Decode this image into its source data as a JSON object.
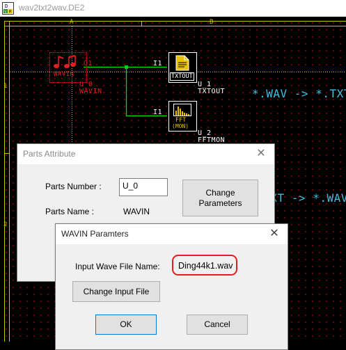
{
  "window": {
    "title": "wav2txt2wav.DE2"
  },
  "canvas": {
    "columns": [
      "A",
      "B"
    ],
    "rows": [
      "1",
      "2"
    ],
    "parts": [
      {
        "id": "wavin",
        "ref": "U_0",
        "name": "WAVIN",
        "icon_text": "WAVIN",
        "port_out": "O1"
      },
      {
        "id": "txtout",
        "ref": "U_1",
        "name": "TXTOUT",
        "icon_text": "TXTOUT",
        "port_in": "I1"
      },
      {
        "id": "fftmon",
        "ref": "U_2",
        "name": "FFTMON",
        "icon_text": "FFT",
        "icon_sub": "(MON)",
        "port_in": "I1"
      }
    ],
    "annotations": [
      "*.WAV -> *.TXT",
      "*.TXT -> *.WAV"
    ]
  },
  "parts_attribute_dialog": {
    "title": "Parts Attribute",
    "parts_number_label": "Parts Number :",
    "parts_number_value": "U_0",
    "parts_name_label": "Parts Name :",
    "parts_name_value": "WAVIN",
    "change_parameters_label": "Change\nParameters"
  },
  "wavin_dialog": {
    "title": "WAVIN Paramters",
    "input_wave_label": "Input Wave File Name:",
    "input_wave_value": "Ding44k1.wav",
    "change_input_label": "Change Input File",
    "ok_label": "OK",
    "cancel_label": "Cancel"
  },
  "colors": {
    "grid_line": "#c8c800",
    "wire": "#00d000",
    "highlight": "#e02020",
    "annotation": "#40c0e0"
  },
  "icons": [
    "app-icon",
    "close-icon",
    "music-notes-icon",
    "document-icon",
    "spectrum-icon"
  ]
}
